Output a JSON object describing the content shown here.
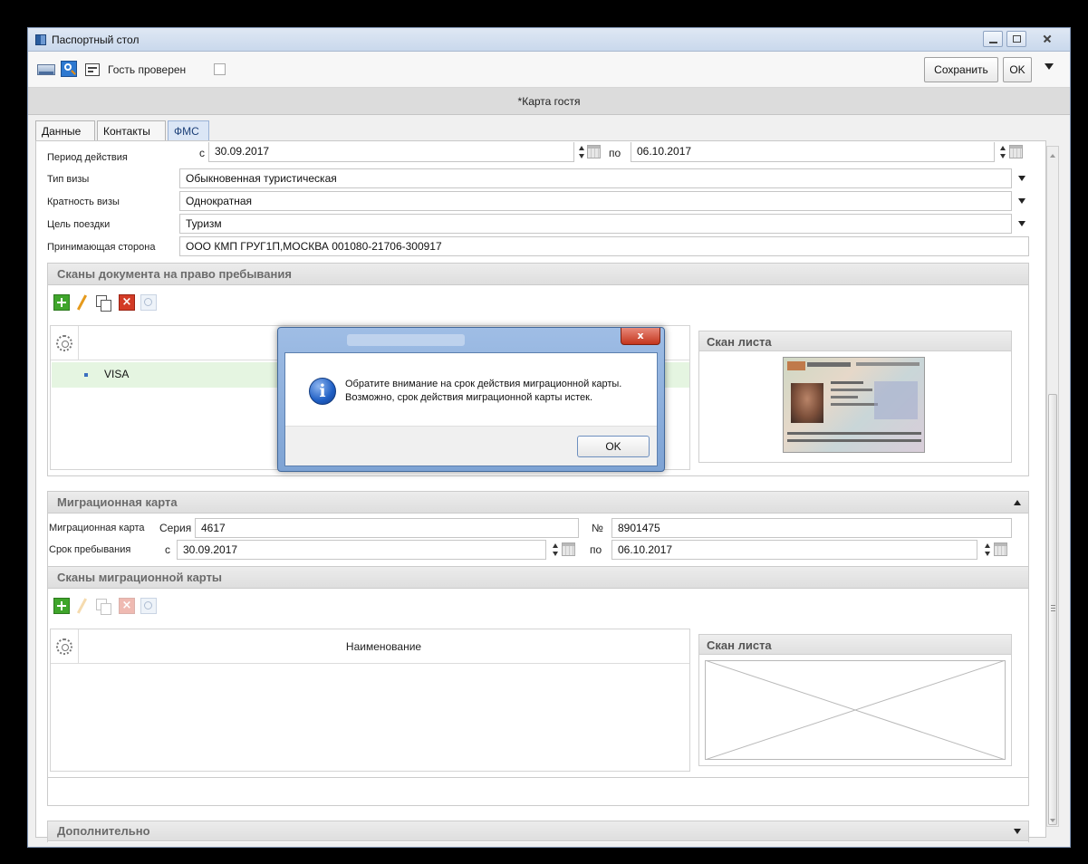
{
  "window": {
    "title": "Паспортный стол",
    "accent_color": "#2a5d9f"
  },
  "toolbar": {
    "guest_checked_label": "Гость проверен",
    "guest_checked": false,
    "save_label": "Сохранить",
    "ok_label": "OK"
  },
  "caption": "*Карта гостя",
  "tabs": [
    {
      "label": "Данные",
      "active": false
    },
    {
      "label": "Контакты",
      "active": false
    },
    {
      "label": "ФМС",
      "active": true
    }
  ],
  "fms": {
    "period": {
      "label": "Период действия",
      "from_prefix": "с",
      "from": "30.09.2017",
      "to_prefix": "по",
      "to": "06.10.2017"
    },
    "visa_type": {
      "label": "Тип визы",
      "value": "Обыкновенная туристическая"
    },
    "visa_multiplicity": {
      "label": "Кратность визы",
      "value": "Однократная"
    },
    "trip_purpose": {
      "label": "Цель поездки",
      "value": "Туризм"
    },
    "host_party": {
      "label": "Принимающая сторона",
      "value": "ООО КМП ГРУГ1П,МОСКВА 001080-21706-300917"
    }
  },
  "residence_scans": {
    "title": "Сканы документа на право пребывания",
    "rows": [
      {
        "name": "VISA"
      }
    ],
    "scan_panel_title": "Скан листа"
  },
  "dialog": {
    "title": "",
    "close_label": "x",
    "line1": "Обратите внимание на срок действия миграционной карты.",
    "line2": "Возможно, срок действия миграционной карты истек.",
    "ok_label": "OK",
    "info_glyph": "i"
  },
  "migration_card": {
    "title": "Миграционная карта",
    "card_label": "Миграционная карта",
    "series_label": "Серия",
    "series": "4617",
    "number_label": "№",
    "number": "8901475",
    "stay_label": "Срок пребывания",
    "from_prefix": "с",
    "from": "30.09.2017",
    "to_prefix": "по",
    "to": "06.10.2017"
  },
  "migration_scans": {
    "title": "Сканы миграционной карты",
    "column_name": "Наименование",
    "scan_panel_title": "Скан листа"
  },
  "additional": {
    "title": "Дополнительно"
  },
  "icons": {
    "delete_glyph": "×"
  }
}
